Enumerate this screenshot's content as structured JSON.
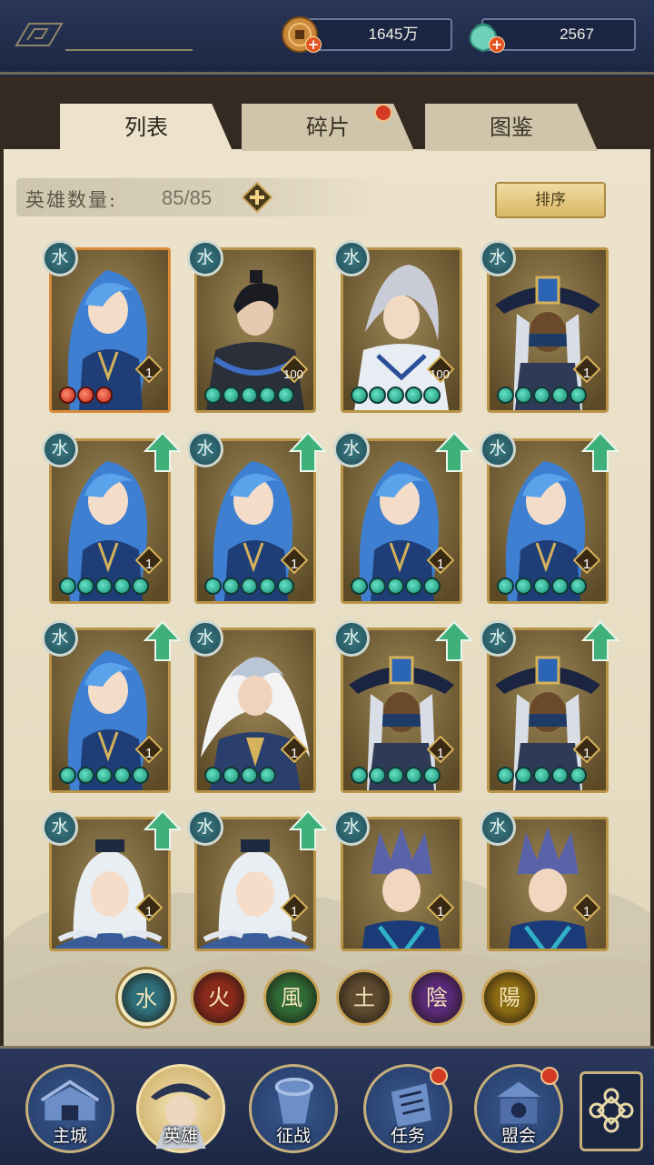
{
  "resources": {
    "coins": "1645万",
    "jade": "2567"
  },
  "tabs": [
    {
      "label": "列表",
      "active": true
    },
    {
      "label": "碎片",
      "active": false,
      "notify": true
    },
    {
      "label": "图鉴",
      "active": false
    }
  ],
  "hero_count": {
    "label": "英雄数量:",
    "value": "85/85"
  },
  "sort_button": "排序",
  "heroes": [
    {
      "art": "blue-hair-heroine",
      "element": "水",
      "level": "1",
      "stars": 3,
      "star_color": "red",
      "upgrade": false,
      "highlight": true
    },
    {
      "art": "black-armor-general",
      "element": "水",
      "level": "100",
      "stars": 5,
      "star_color": "green",
      "upgrade": false
    },
    {
      "art": "silver-hair-swordsman",
      "element": "水",
      "level": "100",
      "stars": 5,
      "star_color": "green",
      "upgrade": false
    },
    {
      "art": "masked-hat-assassin",
      "element": "水",
      "level": "1",
      "stars": 5,
      "star_color": "green",
      "upgrade": false
    },
    {
      "art": "blue-hair-heroine",
      "element": "水",
      "level": "1",
      "stars": 5,
      "star_color": "green",
      "upgrade": true
    },
    {
      "art": "blue-hair-heroine",
      "element": "水",
      "level": "1",
      "stars": 5,
      "star_color": "green",
      "upgrade": true
    },
    {
      "art": "blue-hair-heroine",
      "element": "水",
      "level": "1",
      "stars": 5,
      "star_color": "green",
      "upgrade": true
    },
    {
      "art": "blue-hair-heroine",
      "element": "水",
      "level": "1",
      "stars": 5,
      "star_color": "green",
      "upgrade": true
    },
    {
      "art": "blue-hair-heroine",
      "element": "水",
      "level": "1",
      "stars": 5,
      "star_color": "green",
      "upgrade": true
    },
    {
      "art": "white-hair-lord",
      "element": "水",
      "level": "1",
      "stars": 4,
      "star_color": "green",
      "upgrade": false
    },
    {
      "art": "masked-hat-assassin",
      "element": "水",
      "level": "1",
      "stars": 5,
      "star_color": "green",
      "upgrade": true
    },
    {
      "art": "masked-hat-assassin",
      "element": "水",
      "level": "1",
      "stars": 5,
      "star_color": "green",
      "upgrade": true
    },
    {
      "art": "crowned-maiden",
      "element": "水",
      "level": "1",
      "stars": 0,
      "star_color": "green",
      "upgrade": true
    },
    {
      "art": "crowned-maiden",
      "element": "水",
      "level": "1",
      "stars": 0,
      "star_color": "green",
      "upgrade": true
    },
    {
      "art": "spiky-hair-warrior",
      "element": "水",
      "level": "1",
      "stars": 0,
      "star_color": "green",
      "upgrade": false
    },
    {
      "art": "spiky-hair-warrior",
      "element": "水",
      "level": "1",
      "stars": 0,
      "star_color": "green",
      "upgrade": false
    }
  ],
  "element_filters": [
    {
      "glyph": "水",
      "name": "water",
      "color": "#2e6f7a",
      "active": true
    },
    {
      "glyph": "火",
      "name": "fire",
      "color": "#8a2a1c"
    },
    {
      "glyph": "風",
      "name": "wind",
      "color": "#2f6a35"
    },
    {
      "glyph": "土",
      "name": "earth",
      "color": "#5e4a2e"
    },
    {
      "glyph": "陰",
      "name": "yin",
      "color": "#5a2a78"
    },
    {
      "glyph": "陽",
      "name": "yang",
      "color": "#8a6a12"
    }
  ],
  "nav": [
    {
      "label": "主城",
      "icon": "city-gate-icon"
    },
    {
      "label": "英雄",
      "icon": "hero-portrait-icon",
      "active": true
    },
    {
      "label": "征战",
      "icon": "battle-horn-icon"
    },
    {
      "label": "任务",
      "icon": "task-bell-icon",
      "notify": true
    },
    {
      "label": "盟会",
      "icon": "alliance-hall-icon",
      "notify": true
    }
  ],
  "colors": {
    "paper": "#ede3cc",
    "frame_gold": "#b99448",
    "notify_red": "#d23a24",
    "star_green": "#178a73"
  }
}
